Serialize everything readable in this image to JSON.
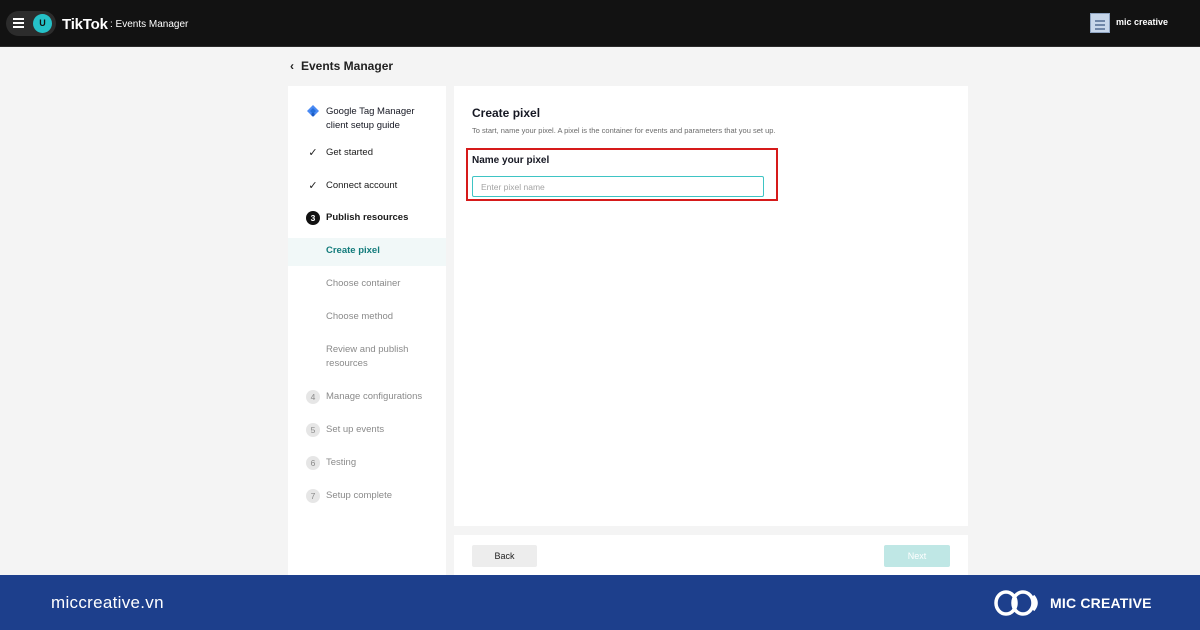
{
  "topbar": {
    "avatar_letter": "U",
    "brand": "TikTok",
    "brand_sub": ": Events Manager",
    "account_name": "mic creative"
  },
  "breadcrumb": {
    "label": "Events Manager"
  },
  "sidebar": {
    "guide_title_line1": "Google Tag Manager",
    "guide_title_line2": "client setup guide",
    "steps": [
      {
        "label": "Get started",
        "state": "done"
      },
      {
        "label": "Connect account",
        "state": "done"
      },
      {
        "number": "3",
        "label": "Publish resources",
        "state": "current"
      },
      {
        "number": "4",
        "label": "Manage configurations",
        "state": "pending"
      },
      {
        "number": "5",
        "label": "Set up events",
        "state": "pending"
      },
      {
        "number": "6",
        "label": "Testing",
        "state": "pending"
      },
      {
        "number": "7",
        "label": "Setup complete",
        "state": "pending"
      }
    ],
    "substeps": [
      {
        "label": "Create pixel",
        "active": true
      },
      {
        "label": "Choose container"
      },
      {
        "label": "Choose method"
      },
      {
        "label_line1": "Review and publish",
        "label_line2": "resources"
      }
    ]
  },
  "main": {
    "title": "Create pixel",
    "description": "To start, name your pixel. A pixel is the container for events and parameters that you set up.",
    "field_label": "Name your pixel",
    "field_placeholder": "Enter pixel name",
    "field_value": ""
  },
  "footer": {
    "back_label": "Back",
    "next_label": "Next"
  },
  "banner": {
    "site": "miccreative.vn",
    "brand": "MIC CREATIVE"
  },
  "colors": {
    "accent_teal": "#127b7b",
    "highlight_red": "#d61a1a",
    "banner_blue": "#1d3f8c",
    "next_disabled": "#bfe7e5"
  }
}
